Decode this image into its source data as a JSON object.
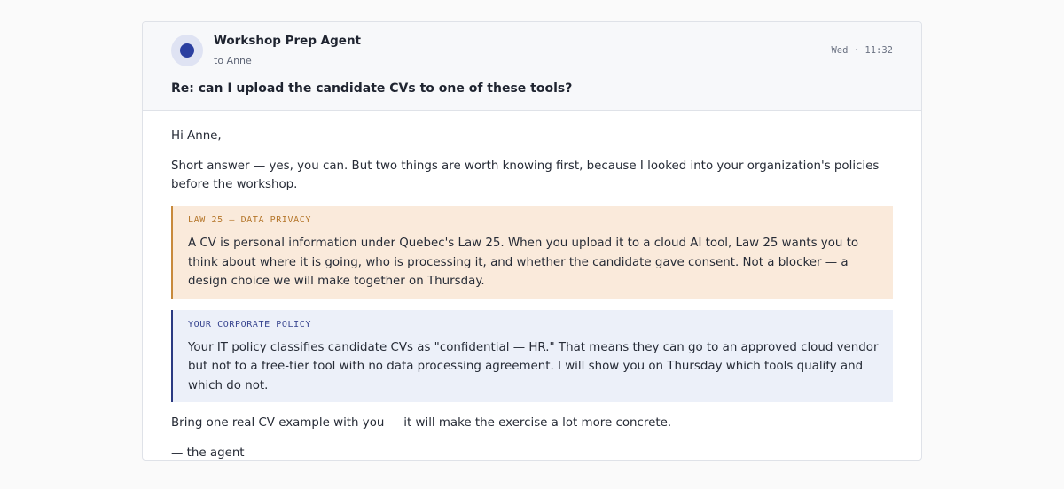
{
  "email": {
    "sender": "Workshop Prep Agent",
    "recipient": "to Anne",
    "timestamp": "Wed · 11:32",
    "subject": "Re: can I upload the candidate CVs to one of these tools?",
    "avatar_icon": "avatar-dot-icon",
    "greeting": "Hi Anne,",
    "intro": "Short answer — yes, you can. But two things are worth knowing first, because I looked into your organization's policies before the workshop.",
    "callouts": [
      {
        "label": "LAW 25 — DATA PRIVACY",
        "text": "A CV is personal information under Quebec's Law 25. When you upload it to a cloud AI tool, Law 25 wants you to think about where it is going, who is processing it, and whether the candidate gave consent. Not a blocker — a design choice we will make together on Thursday.",
        "color": "#c88a3c"
      },
      {
        "label": "YOUR CORPORATE POLICY",
        "text": "Your IT policy classifies candidate CVs as \"confidential — HR.\" That means they can go to an approved cloud vendor but not to a free-tier tool with no data processing agreement. I will show you on Thursday which tools qualify and which do not.",
        "color": "#2b3a82"
      }
    ],
    "closing": "Bring one real CV example with you — it will make the exercise a lot more concrete.",
    "signature": "— the agent"
  }
}
